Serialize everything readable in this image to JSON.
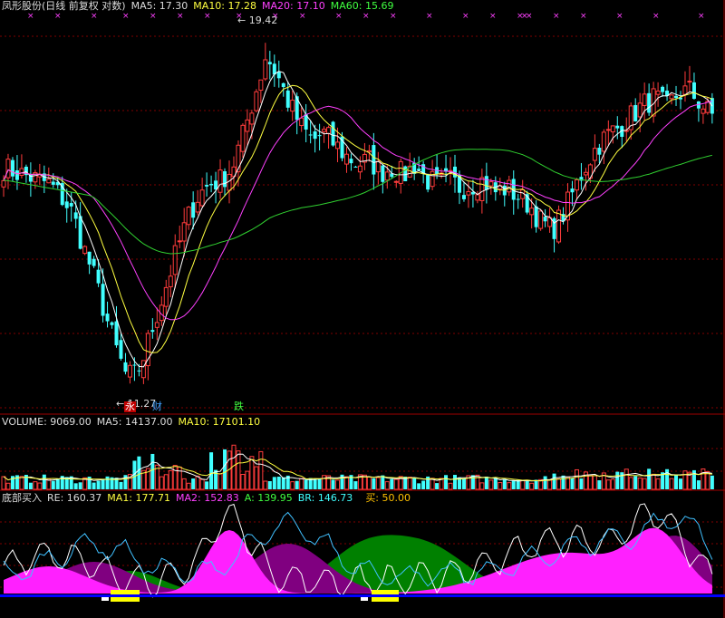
{
  "main_header": {
    "title": "凤形股份(日线 前复权 对数)",
    "ma5": "MA5: 17.30",
    "ma10": "MA10: 17.28",
    "ma20": "MA20: 17.10",
    "ma60": "MA60: 15.69"
  },
  "volume_header": {
    "volume": "VOLUME: 9069.00",
    "ma5": "MA5: 14137.00",
    "ma10": "MA10: 17101.10"
  },
  "indicator_header": {
    "name": "底部买入",
    "re": "RE: 160.37",
    "ma1": "MA1: 177.71",
    "ma2": "MA2: 152.83",
    "a": "A: 139.95",
    "br": "BR: 146.73",
    "buy": "买: 50.00"
  },
  "annotations": {
    "high_label": "19.42",
    "low_label": "11.27",
    "marker_1": "永",
    "marker_2": "财",
    "marker_3": "跌"
  },
  "colors": {
    "up": "#ff3c3c",
    "down": "#40ffff",
    "ma5": "#ffffff",
    "ma10": "#ffff40",
    "ma20": "#ff40ff",
    "ma60": "#30d030",
    "grid": "#800000",
    "magenta_fill": "#ff20ff",
    "purple_fill": "#800080",
    "green_fill": "#008000",
    "blue_line": "#0000ff",
    "buy_bar": "#ffff00"
  },
  "chart_data": {
    "type": "candlestick",
    "title": "凤形股份(日线 前复权 对数)",
    "y_scale": "log",
    "price_range": [
      11.27,
      19.42
    ],
    "high": 19.42,
    "low": 11.27,
    "moving_averages": [
      {
        "name": "MA5",
        "value": 17.3
      },
      {
        "name": "MA10",
        "value": 17.28
      },
      {
        "name": "MA20",
        "value": 17.1
      },
      {
        "name": "MA60",
        "value": 15.69
      }
    ],
    "volume": {
      "VOLUME": 9069.0,
      "MA5": 14137.0,
      "MA10": 17101.1
    },
    "indicator": {
      "name": "底部买入",
      "RE": 160.37,
      "MA1": 177.71,
      "MA2": 152.83,
      "A": 139.95,
      "BR": 146.73,
      "买": 50.0
    },
    "close_path": [
      15.9,
      15.8,
      15.7,
      15.6,
      15.5,
      15.2,
      14.8,
      14.0,
      13.3,
      12.5,
      11.8,
      11.27,
      11.6,
      12.3,
      13.0,
      13.8,
      14.6,
      15.2,
      15.5,
      15.6,
      15.9,
      16.8,
      17.9,
      19.0,
      18.4,
      17.6,
      17.0,
      16.6,
      16.8,
      16.5,
      16.2,
      16.0,
      16.1,
      15.8,
      15.9,
      15.7,
      16.0,
      15.6,
      15.5,
      15.6,
      15.4,
      15.5,
      15.6,
      15.3,
      15.4,
      15.2,
      15.0,
      14.6,
      14.4,
      14.8,
      15.4,
      16.0,
      16.5,
      16.8,
      17.0,
      17.3,
      17.6,
      17.8,
      17.5,
      17.9,
      18.0,
      17.6,
      17.3
    ]
  }
}
